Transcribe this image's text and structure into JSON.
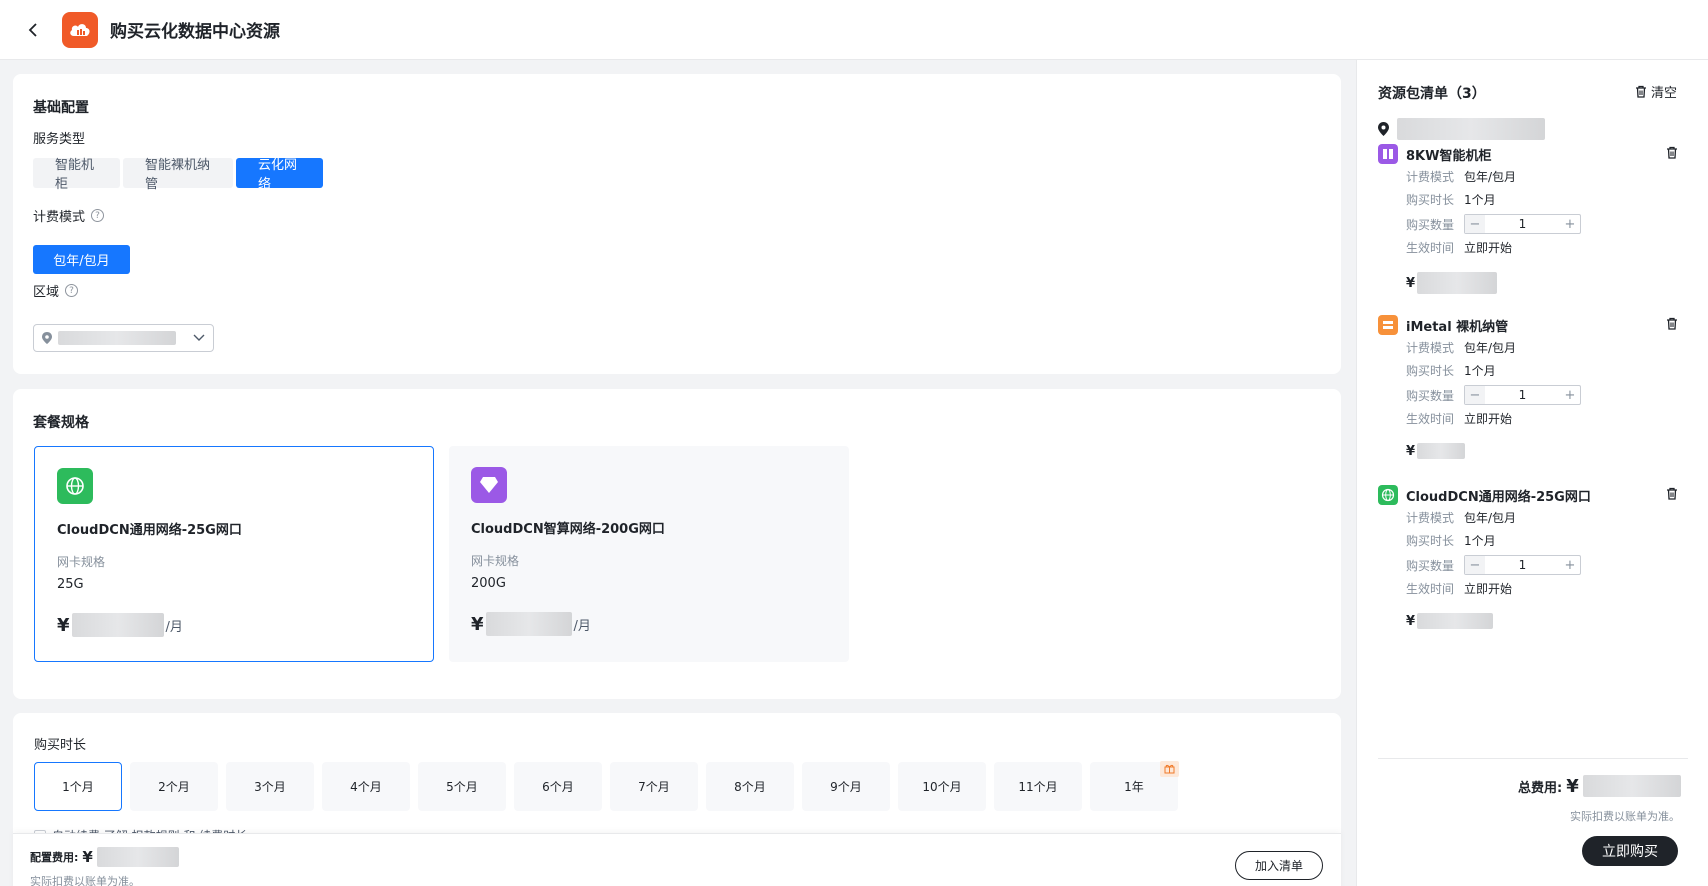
{
  "header": {
    "title": "购买云化数据中心资源"
  },
  "basic": {
    "section_title": "基础配置",
    "service_type_label": "服务类型",
    "service_types": [
      {
        "label": "智能机柜",
        "active": false
      },
      {
        "label": "智能裸机纳管",
        "active": false
      },
      {
        "label": "云化网络",
        "active": true
      }
    ],
    "billing_label": "计费模式",
    "billing_option": "包年/包月",
    "region_label": "区域"
  },
  "package": {
    "section_title": "套餐规格",
    "cards": [
      {
        "name": "CloudDCN通用网络-25G网口",
        "spec_label": "网卡规格",
        "spec_value": "25G",
        "currency": "¥",
        "unit": "/月",
        "icon": "globe-icon",
        "selected": true
      },
      {
        "name": "CloudDCN智算网络-200G网口",
        "spec_label": "网卡规格",
        "spec_value": "200G",
        "currency": "¥",
        "unit": "/月",
        "icon": "diamond-icon",
        "selected": false
      }
    ]
  },
  "duration": {
    "section_title": "购买时长",
    "options": [
      "1个月",
      "2个月",
      "3个月",
      "4个月",
      "5个月",
      "6个月",
      "7个月",
      "8个月",
      "9个月",
      "10个月",
      "11个月",
      "1年"
    ],
    "active_index": 0,
    "auto_renew_text": "自动续费 了解 扣款规则 和 续费时长"
  },
  "bottom": {
    "fee_label": "配置费用:",
    "currency": "¥",
    "note": "实际扣费以账单为准。",
    "add_button": "加入清单"
  },
  "cart": {
    "title": "资源包清单（3）",
    "clear": "清空",
    "items": [
      {
        "name": "8KW智能机柜",
        "icon": "cabinet-icon",
        "icon_color": "#9b59e6",
        "billing_label": "计费模式",
        "billing_value": "包年/包月",
        "duration_label": "购买时长",
        "duration_value": "1个月",
        "qty_label": "购买数量",
        "qty": "1",
        "effect_label": "生效时间",
        "effect_value": "立即开始",
        "currency": "¥"
      },
      {
        "name": "iMetal 裸机纳管",
        "icon": "server-icon",
        "icon_color": "#f7913a",
        "billing_label": "计费模式",
        "billing_value": "包年/包月",
        "duration_label": "购买时长",
        "duration_value": "1个月",
        "qty_label": "购买数量",
        "qty": "1",
        "effect_label": "生效时间",
        "effect_value": "立即开始",
        "currency": "¥"
      },
      {
        "name": "CloudDCN通用网络-25G网口",
        "icon": "globe-icon",
        "icon_color": "#2dbb5c",
        "billing_label": "计费模式",
        "billing_value": "包年/包月",
        "duration_label": "购买时长",
        "duration_value": "1个月",
        "qty_label": "购买数量",
        "qty": "1",
        "effect_label": "生效时间",
        "effect_value": "立即开始",
        "currency": "¥"
      }
    ],
    "total_label": "总费用:",
    "currency": "¥",
    "total_note": "实际扣费以账单为准。",
    "buy_button": "立即购买"
  },
  "colors": {
    "primary": "#1677ff",
    "dark": "#1f2329",
    "logo": "#f05a28"
  }
}
